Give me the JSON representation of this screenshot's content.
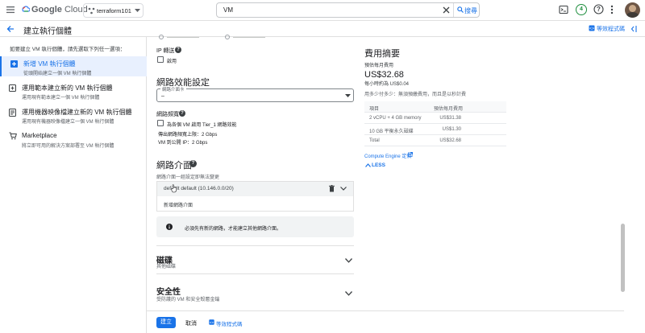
{
  "topbar": {
    "brand_google": "Google",
    "brand_cloud": "Cloud",
    "project_name": "terraform101",
    "search_value": "VM",
    "search_button": "搜尋",
    "notification_count": "4"
  },
  "subheader": {
    "title": "建立執行個體",
    "equivalent_code": "等效程式碼"
  },
  "sidebar": {
    "instruction": "如要建立 VM 執行個體，請先選取下列任一選項：",
    "items": [
      {
        "title": "新增 VM 執行個體",
        "subtitle": "從頭開始建立一個 VM 執行個體"
      },
      {
        "title": "運用範本建立新的 VM 執行個體",
        "subtitle": "運用現有範本建立一個 VM 執行個體"
      },
      {
        "title": "運用機器映像檔建立新的 VM 執行個體",
        "subtitle": "運用現有機器映像檔建立一個 VM 執行個體"
      },
      {
        "title": "Marketplace",
        "subtitle": "將立即可用的解決方案部署至 VM 執行個體"
      }
    ]
  },
  "main": {
    "ip_forwarding_label": "IP 轉送",
    "ip_forwarding_checkbox": "啟用",
    "network_performance_heading": "網路效能設定",
    "network_interface_card_label": "網路介面卡",
    "network_interface_card_value": "–",
    "network_bandwidth_label": "網路頻寬",
    "tier1_checkbox": "為各個 VM 啟用 Tier_1 網路效能",
    "egress_bandwidth": "傳出網路頻寬上限：2 Gbps",
    "vm_to_external": "VM 到公開 IP：2 Gbps",
    "network_interfaces_heading": "網路介面",
    "network_interfaces_help": "網路介面一經設定即無法變更",
    "interface_value": "default default (10.146.0.0/20)",
    "add_interface": "新增網路介面",
    "info_message": "必須先有新的網路，才能建立其他網路介面。",
    "disks_heading": "磁碟",
    "disks_sub": "其他磁碟",
    "security_heading": "安全性",
    "security_sub": "受防護的 VM 和安全殼層金鑰"
  },
  "summary": {
    "heading": "費用摘要",
    "monthly_label": "預估每月費用",
    "monthly_cost": "US$32.68",
    "hourly": "每小時約為 US$0.04",
    "usage_note": "用多少付多少：無須預繳費用，而且是以秒計費",
    "columns": [
      "項目",
      "預估每月費用"
    ],
    "rows": [
      {
        "item": "2 vCPU + 4 GB memory",
        "cost": "US$31.38"
      },
      {
        "item": "10 GB 平衡永久磁碟",
        "cost": "US$1.30"
      },
      {
        "item": "Total",
        "cost": "US$32.68"
      }
    ],
    "pricing_link": "Compute Engine 定價",
    "less_toggle": "LESS"
  },
  "bottombar": {
    "create": "建立",
    "cancel": "取消",
    "equivalent_code": "等效程式碼"
  },
  "colors": {
    "accent": "#1a73e8",
    "selected_bg": "#e8f0fe",
    "badge": "#1e8e3e"
  }
}
